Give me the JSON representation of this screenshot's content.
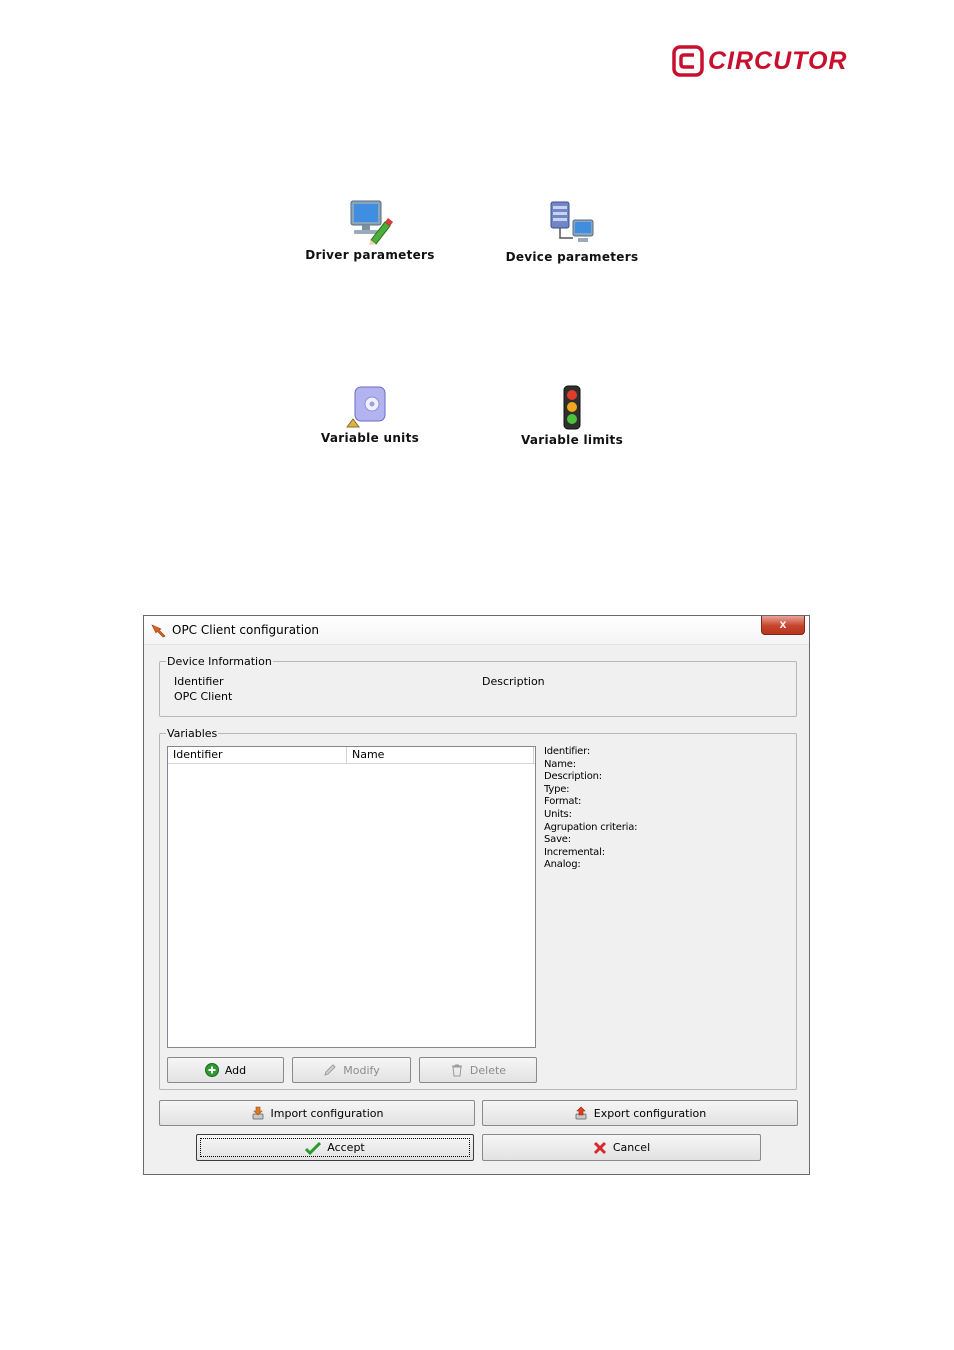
{
  "logo": {
    "text": "CIRCUTOR",
    "color": "#c8102e"
  },
  "icons": [
    {
      "id": "driver",
      "label": "Driver parameters",
      "icon": "computer-pencil-icon"
    },
    {
      "id": "device",
      "label": "Device parameters",
      "icon": "network-computers-icon"
    },
    {
      "id": "units",
      "label": "Variable units",
      "icon": "disc-drive-icon"
    },
    {
      "id": "limits",
      "label": "Variable limits",
      "icon": "traffic-light-icon"
    }
  ],
  "dialog": {
    "title": "OPC Client configuration",
    "close_label": "x",
    "device_info": {
      "legend": "Device Information",
      "identifier_label": "Identifier",
      "identifier_value": "OPC Client",
      "description_label": "Description"
    },
    "variables": {
      "legend": "Variables",
      "columns": [
        "Identifier",
        "Name"
      ],
      "details": [
        "Identifier:",
        "Name:",
        "Description:",
        "Type:",
        "Format:",
        "Units:",
        "Agrupation criteria:",
        "Save:",
        "Incremental:",
        "Analog:"
      ],
      "add_label": "Add",
      "modify_label": "Modify",
      "delete_label": "Delete"
    },
    "import_label": "Import configuration",
    "export_label": "Export configuration",
    "accept_label": "Accept",
    "cancel_label": "Cancel"
  }
}
